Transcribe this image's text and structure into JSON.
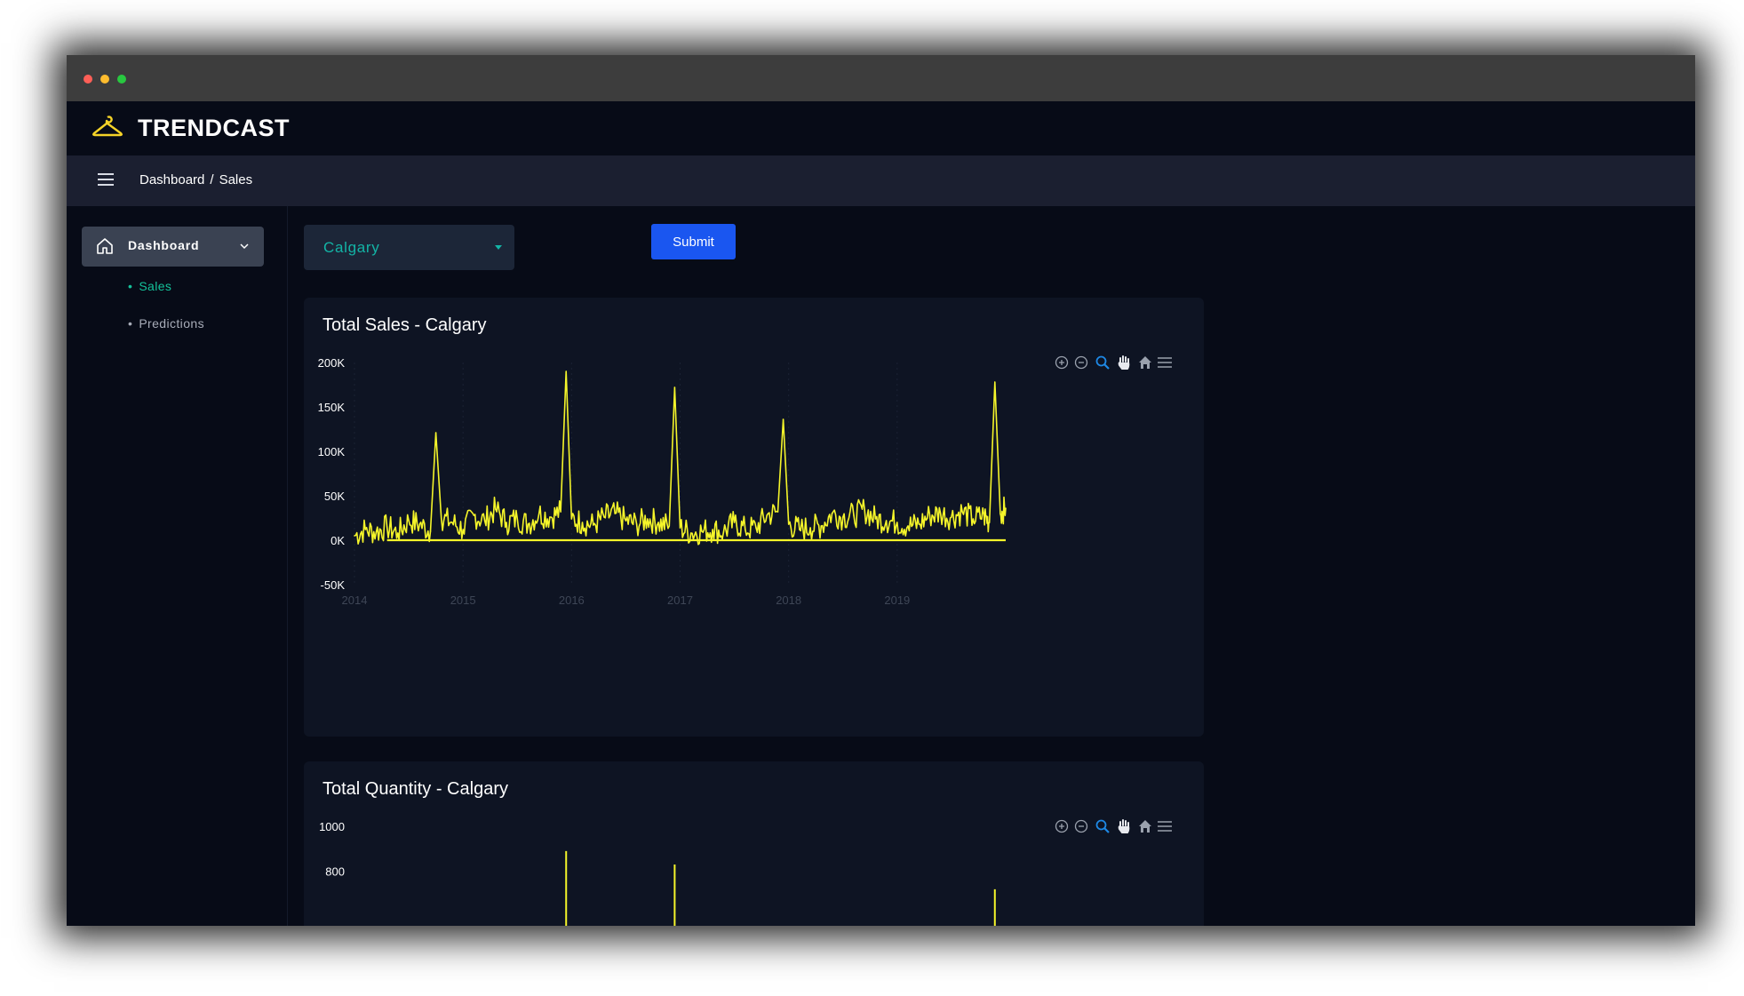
{
  "window": {
    "traffic_lights": [
      "red",
      "yellow",
      "green"
    ]
  },
  "app": {
    "brand": "TRENDCAST",
    "logo_icon": "hanger-icon"
  },
  "breadcrumb": {
    "first": "Dashboard",
    "separator": "/",
    "current": "Sales"
  },
  "sidebar": {
    "dashboard_label": "Dashboard",
    "items": [
      {
        "label": "Sales",
        "active": true
      },
      {
        "label": "Predictions",
        "active": false
      }
    ]
  },
  "filter": {
    "selected_city": "Calgary"
  },
  "submit_label": "Submit",
  "colors": {
    "accent": "#13b4a6",
    "series": "#f5f52a",
    "button": "#1a56f0"
  },
  "chart_toolbar_icons": [
    "zoom-in-icon",
    "zoom-out-icon",
    "zoom-select-icon",
    "pan-hand-icon",
    "home-reset-icon",
    "menu-icon"
  ],
  "chart_data": [
    {
      "type": "line",
      "title": "Total Sales - Calgary",
      "ylim": [
        -50000,
        200000
      ],
      "yticks": [
        "-50K",
        "0K",
        "50K",
        "100K",
        "150K",
        "200K"
      ],
      "xticks": [
        "2014",
        "2015",
        "2016",
        "2017",
        "2018",
        "2019"
      ],
      "xlim": [
        2014.0,
        2020.0
      ],
      "grid": false,
      "series": [
        {
          "color": "#f5f52a",
          "x": [
            2014.0,
            2014.1,
            2014.2,
            2014.3,
            2014.4,
            2014.5,
            2014.6,
            2014.7,
            2014.75,
            2014.8,
            2014.9,
            2015.0,
            2015.1,
            2015.2,
            2015.3,
            2015.4,
            2015.5,
            2015.6,
            2015.7,
            2015.8,
            2015.9,
            2015.95,
            2016.0,
            2016.1,
            2016.2,
            2016.3,
            2016.4,
            2016.5,
            2016.6,
            2016.7,
            2016.8,
            2016.9,
            2016.95,
            2017.0,
            2017.1,
            2017.2,
            2017.3,
            2017.4,
            2017.5,
            2017.6,
            2017.7,
            2017.8,
            2017.9,
            2017.95,
            2018.0,
            2018.1,
            2018.2,
            2018.3,
            2018.4,
            2018.5,
            2018.6,
            2018.7,
            2018.8,
            2018.9,
            2019.0,
            2019.1,
            2019.2,
            2019.3,
            2019.4,
            2019.5,
            2019.6,
            2019.7,
            2019.8,
            2019.85,
            2019.9,
            2019.95,
            2020.0
          ],
          "y": [
            5000,
            12000,
            9000,
            15000,
            8000,
            22000,
            18000,
            10000,
            121000,
            25000,
            20000,
            12000,
            28000,
            22000,
            35000,
            20000,
            24000,
            18000,
            30000,
            26000,
            32000,
            190000,
            24000,
            20000,
            17000,
            26000,
            30000,
            22000,
            18000,
            24000,
            20000,
            16000,
            172000,
            14000,
            8000,
            10000,
            12000,
            9000,
            20000,
            12000,
            14000,
            28000,
            32000,
            136000,
            18000,
            12000,
            14000,
            16000,
            30000,
            26000,
            28000,
            34000,
            24000,
            22000,
            20000,
            16000,
            18000,
            28000,
            30000,
            26000,
            32000,
            24000,
            28000,
            20000,
            178000,
            30000,
            36000
          ]
        }
      ]
    },
    {
      "type": "line",
      "title": "Total Quantity - Calgary",
      "ylim": [
        0,
        1000
      ],
      "yticks": [
        "800",
        "1000"
      ],
      "grid": false,
      "series": [
        {
          "color": "#f5f52a",
          "x": [
            2015.95,
            2016.95,
            2019.9
          ],
          "y": [
            890,
            830,
            720
          ]
        }
      ]
    }
  ]
}
